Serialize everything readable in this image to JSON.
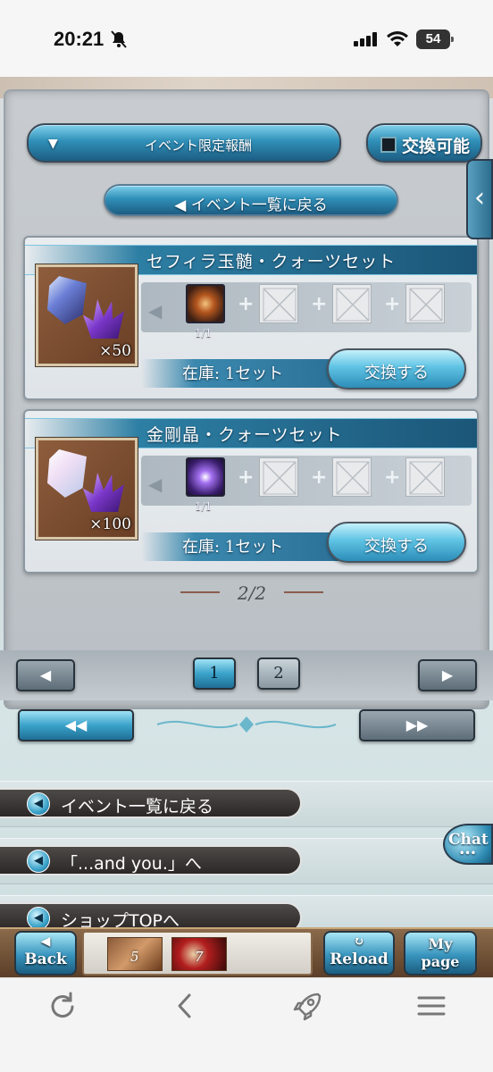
{
  "status_bar": {
    "time": "20:21",
    "battery": "54"
  },
  "filter": {
    "label": "イベント限定報酬",
    "toggle_label": "交換可能"
  },
  "back_to_event_list_button": "◀ イベント一覧に戻る",
  "side_tab_arrow": "‹",
  "items": [
    {
      "title": "セフィラ玉髄・クォーツセット",
      "reward_qty": "×50",
      "material_count": "1/1",
      "stock": "在庫: 1セット",
      "exchange_label": "交換する"
    },
    {
      "title": "金剛晶・クォーツセット",
      "reward_qty": "×100",
      "material_count": "1/1",
      "stock": "在庫: 1セット",
      "exchange_label": "交換する"
    }
  ],
  "page_indicator": "2/2",
  "pager": {
    "prev": "◀",
    "next": "▶",
    "pages": [
      "1",
      "2"
    ],
    "first": "◀◀",
    "last": "▶▶",
    "current_page": 1
  },
  "links": [
    "イベント一覧に戻る",
    "「...and you.」へ",
    "ショップTOPへ"
  ],
  "chat": {
    "label": "Chat",
    "dots": "•••"
  },
  "gamebar": {
    "back": "Back",
    "reload": "Reload",
    "mypage_line1": "My",
    "mypage_line2": "page",
    "party_nums": [
      "5",
      "7"
    ]
  },
  "icons": {
    "bell": "bell-slash-icon",
    "signal": "signal-icon",
    "wifi": "wifi-icon",
    "refresh": "refresh-icon",
    "back": "chevron-left-icon",
    "rocket": "rocket-icon",
    "menu": "menu-icon"
  }
}
